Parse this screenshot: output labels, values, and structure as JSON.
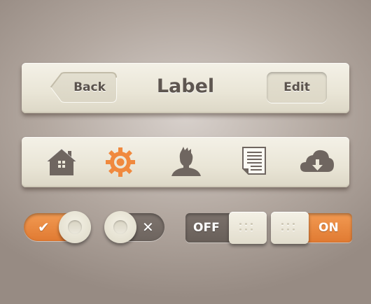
{
  "navbar": {
    "back_label": "Back",
    "title": "Label",
    "edit_label": "Edit"
  },
  "tabbar": {
    "items": [
      {
        "icon": "home-icon"
      },
      {
        "icon": "gear-icon",
        "active": true
      },
      {
        "icon": "user-icon"
      },
      {
        "icon": "document-icon"
      },
      {
        "icon": "cloud-download-icon"
      }
    ]
  },
  "toggles": {
    "check_toggle": {
      "state": "on",
      "glyph": "✔"
    },
    "x_toggle": {
      "state": "off",
      "glyph": "✕"
    }
  },
  "switches": {
    "off_switch": {
      "label": "OFF",
      "state": "off"
    },
    "on_switch": {
      "label": "ON",
      "state": "on"
    }
  },
  "colors": {
    "accent": "#f0893e",
    "bar": "#ebe7d8",
    "text": "#5e5650",
    "dark_track": "#756b65"
  }
}
